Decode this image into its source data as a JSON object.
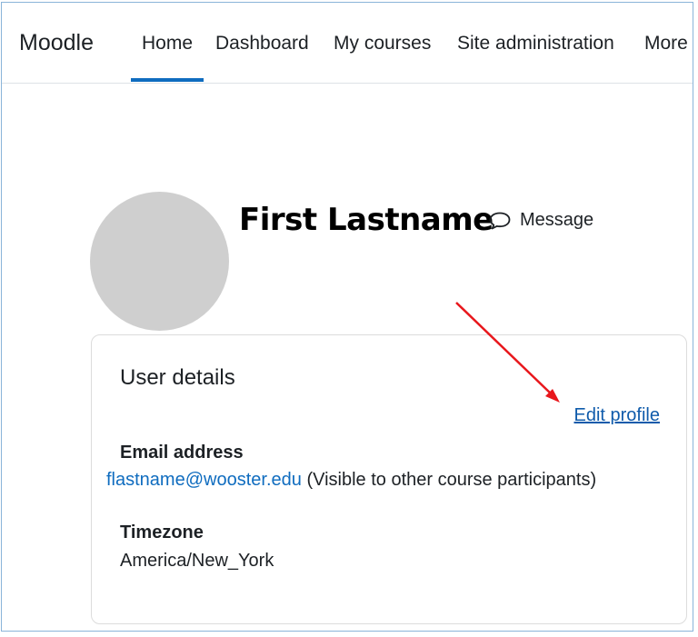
{
  "navbar": {
    "brand": "Moodle",
    "items": [
      {
        "label": "Home",
        "active": true
      },
      {
        "label": "Dashboard",
        "active": false
      },
      {
        "label": "My courses",
        "active": false
      },
      {
        "label": "Site administration",
        "active": false
      },
      {
        "label": "More",
        "active": false
      }
    ]
  },
  "profile": {
    "fullname": "First Lastname",
    "message_label": "Message",
    "avatar_icon": "user-avatar-placeholder",
    "message_icon": "speech-bubble-icon"
  },
  "user_details": {
    "title": "User details",
    "edit_profile": "Edit profile",
    "email_label": "Email address",
    "email_value": "flastname@wooster.edu",
    "email_visibility": "(Visible to other course participants)",
    "timezone_label": "Timezone",
    "timezone_value": "America/New_York"
  },
  "colors": {
    "accent": "#0f6cbf",
    "annotation_arrow": "#e8171c",
    "avatar": "#cfcfcf"
  }
}
